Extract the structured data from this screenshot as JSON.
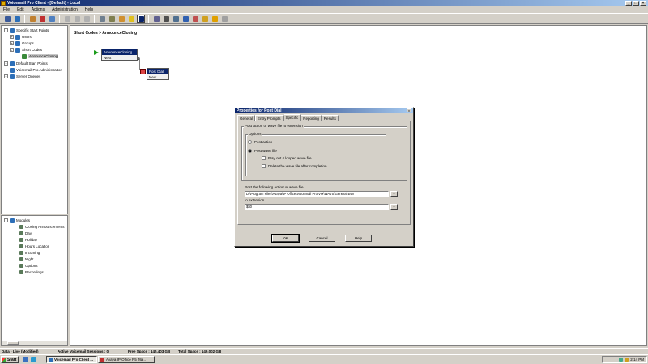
{
  "window": {
    "title": "Voicemail Pro Client - [Default] - Local"
  },
  "menu": {
    "items": [
      "File",
      "Edit",
      "Actions",
      "Administration",
      "Help"
    ]
  },
  "tree": {
    "items": [
      {
        "label": "Specific Start Points",
        "level": 0,
        "expander": "-"
      },
      {
        "label": "Users",
        "level": 1,
        "expander": "+"
      },
      {
        "label": "Groups",
        "level": 1,
        "expander": "+"
      },
      {
        "label": "Short Codes",
        "level": 1,
        "expander": "-"
      },
      {
        "label": "AnnounceClosing",
        "level": 2,
        "expander": "",
        "selected": true
      },
      {
        "label": "Default Start Points",
        "level": 0,
        "expander": "+"
      },
      {
        "label": "Voicemail Pro Administration",
        "level": 0,
        "expander": ""
      },
      {
        "label": "Server Queues",
        "level": 0,
        "expander": "+"
      }
    ]
  },
  "modules": {
    "title": "Modules",
    "expander": "-",
    "items": [
      "Closing Announcements",
      "Day",
      "Holiday",
      "Hours Location",
      "Incoming",
      "Night",
      "Options",
      "Recordings"
    ]
  },
  "canvas": {
    "breadcrumb": "Short Codes > AnnounceClosing",
    "node1": {
      "title": "AnnounceClosing",
      "next": "Next"
    },
    "node2": {
      "title": "Post Dial",
      "next": "Next"
    }
  },
  "dialog": {
    "title": "Properties for Post Dial",
    "close_label": "x",
    "tabs": [
      "General",
      "Entry Prompts",
      "Specific",
      "Reporting",
      "Results"
    ],
    "active_tab": "Specific",
    "group_label": "Post action or wave file to extension",
    "options_label": "Options",
    "radio_post_action": "Post action",
    "radio_post_wave": "Post wave file",
    "check_loop": "Play out a looped wave file",
    "check_delete": "Delete the wave file after completion",
    "field1_label": "Post the following action or wave file",
    "field1_value": "D:\\Program Files\\Avaya\\IP Office\\Voicemail Pro\\VM\\WAVS\\General.wav",
    "field2_label": "to extension",
    "field2_value": "$$0",
    "browse_label": "...",
    "ok_label": "OK",
    "cancel_label": "Cancel",
    "help_label": "Help"
  },
  "status": {
    "mode": "Data - Live (Modified)",
    "sessions": "Active Voicemail Sessions : 0",
    "free_space": "Free Space : 145.403 GB",
    "total_space": "Total Space : 149.002 GB"
  },
  "taskbar": {
    "start_label": "Start",
    "tasks": [
      "Voicemail Pro Client ...",
      "Avaya IP Office R5 Ma..."
    ],
    "clock": "2:14 PM"
  },
  "colors": {
    "title_gradient_start": "#0a246a",
    "title_gradient_end": "#a6caf0",
    "chrome": "#d4d0c8"
  }
}
